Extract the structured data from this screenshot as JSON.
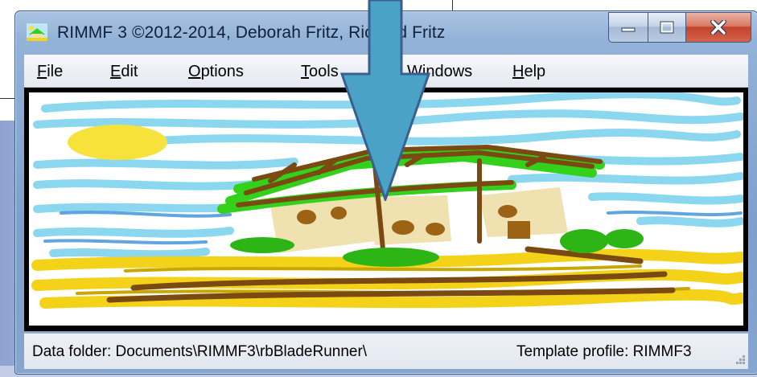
{
  "window": {
    "title": "RIMMF 3   ©2012-2014, Deborah Fritz, Richard Fritz",
    "controls": {
      "minimize_icon": "minimize-icon",
      "maximize_icon": "maximize-icon",
      "close_icon": "close-icon"
    }
  },
  "menu": {
    "items": [
      {
        "label_mnemonic": "F",
        "label_rest": "ile"
      },
      {
        "label_mnemonic": "E",
        "label_rest": "dit"
      },
      {
        "label_mnemonic": "O",
        "label_rest": "ptions"
      },
      {
        "label_mnemonic": "T",
        "label_rest": "ools"
      },
      {
        "label_mnemonic": "W",
        "label_rest": "indows"
      },
      {
        "label_mnemonic": "H",
        "label_rest": "elp"
      }
    ]
  },
  "statusbar": {
    "data_folder": "Data folder: Documents\\RIMMF3\\rbBladeRunner\\",
    "template_profile": "Template profile: RIMMF3"
  },
  "colors": {
    "arrow_fill": "#4aa3c6",
    "arrow_stroke": "#3a5f8f",
    "sky": "#7fd3ee",
    "sun": "#f6e23a",
    "roof": "#34d11c",
    "wood": "#7a4a12",
    "wall": "#efe1b0",
    "sand": "#f4d21a"
  }
}
